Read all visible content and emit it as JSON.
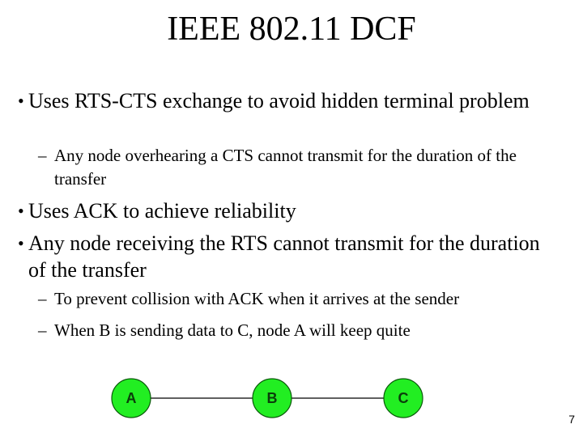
{
  "slide": {
    "title": "IEEE 802.11 DCF",
    "bullets": [
      {
        "level": 1,
        "marker": "•",
        "text": "Uses RTS-CTS exchange to avoid hidden terminal problem"
      },
      {
        "level": 2,
        "marker": "–",
        "text": "Any node overhearing a CTS cannot transmit for the duration of the transfer"
      },
      {
        "level": 1,
        "marker": "•",
        "text": "Uses ACK to achieve reliability"
      },
      {
        "level": 1,
        "marker": "•",
        "text": "Any node receiving the RTS cannot transmit for the duration of the transfer"
      },
      {
        "level": 2,
        "marker": "–",
        "text": "To prevent collision with ACK when it arrives at the sender"
      },
      {
        "level": 2,
        "marker": "–",
        "text": "When B is sending data to C, node A will keep quite"
      }
    ],
    "page_number": "7"
  },
  "diagram": {
    "nodes": [
      {
        "id": "A",
        "label": "A"
      },
      {
        "id": "B",
        "label": "B"
      },
      {
        "id": "C",
        "label": "C"
      }
    ],
    "edges": [
      {
        "from": "A",
        "to": "B"
      },
      {
        "from": "B",
        "to": "C"
      }
    ],
    "colors": {
      "node_fill": "#22ee22",
      "node_stroke": "#0a5a0a",
      "edge": "#000000",
      "label": "#0b3d0b"
    }
  }
}
